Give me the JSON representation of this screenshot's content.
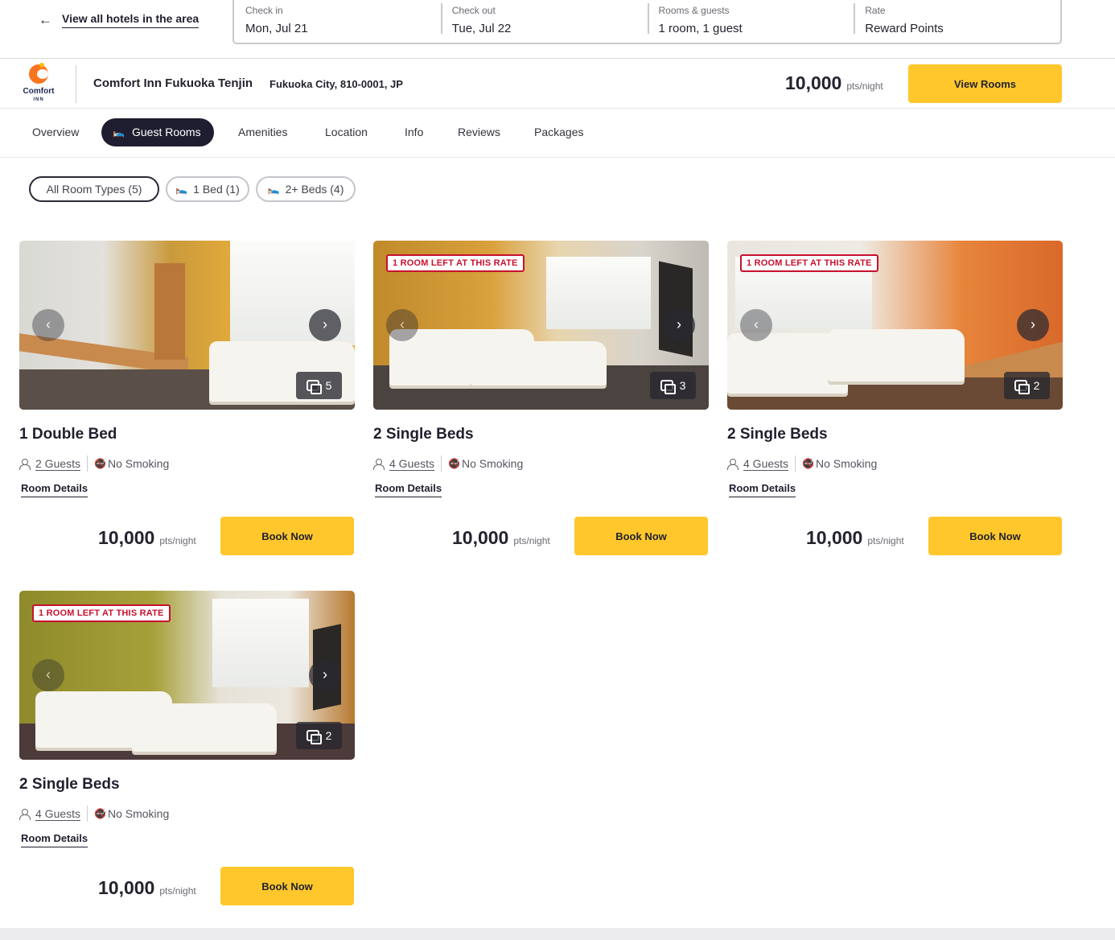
{
  "back_link": "View all hotels in the area",
  "search": {
    "fields": [
      {
        "label": "Check in",
        "value": "Mon, Jul 21"
      },
      {
        "label": "Check out",
        "value": "Tue, Jul 22"
      },
      {
        "label": "Rooms & guests",
        "value": "1 room, 1 guest"
      },
      {
        "label": "Rate",
        "value": "Reward Points"
      }
    ]
  },
  "hotel": {
    "logo_word": "Comfort",
    "logo_sub": "INN",
    "name": "Comfort Inn Fukuoka Tenjin",
    "address": "Fukuoka City, 810-0001, JP",
    "price": "10,000",
    "price_unit": "pts/night",
    "view_rooms": "View Rooms"
  },
  "tabs": [
    "Overview",
    "Guest Rooms",
    "Amenities",
    "Location",
    "Info",
    "Reviews",
    "Packages"
  ],
  "active_tab": "Guest Rooms",
  "filters": [
    "All Room Types (5)",
    "1 Bed (1)",
    "2+ Beds (4)"
  ],
  "rooms": [
    {
      "title": "1 Double Bed",
      "guests": "2 Guests",
      "smoking": "No Smoking",
      "details": "Room Details",
      "price": "10,000",
      "unit": "pts/night",
      "book": "Book Now",
      "photos": "5",
      "badge": ""
    },
    {
      "title": "2 Single Beds",
      "guests": "4 Guests",
      "smoking": "No Smoking",
      "details": "Room Details",
      "price": "10,000",
      "unit": "pts/night",
      "book": "Book Now",
      "photos": "3",
      "badge": "1 ROOM LEFT AT THIS RATE"
    },
    {
      "title": "2 Single Beds",
      "guests": "4 Guests",
      "smoking": "No Smoking",
      "details": "Room Details",
      "price": "10,000",
      "unit": "pts/night",
      "book": "Book Now",
      "photos": "2",
      "badge": "1 ROOM LEFT AT THIS RATE"
    },
    {
      "title": "2 Single Beds",
      "guests": "4 Guests",
      "smoking": "No Smoking",
      "details": "Room Details",
      "price": "10,000",
      "unit": "pts/night",
      "book": "Book Now",
      "photos": "2",
      "badge": "1 ROOM LEFT AT THIS RATE"
    }
  ],
  "colors": {
    "accent": "#ffc72c",
    "dark": "#1e1e30",
    "badge_red": "#c8102e"
  }
}
